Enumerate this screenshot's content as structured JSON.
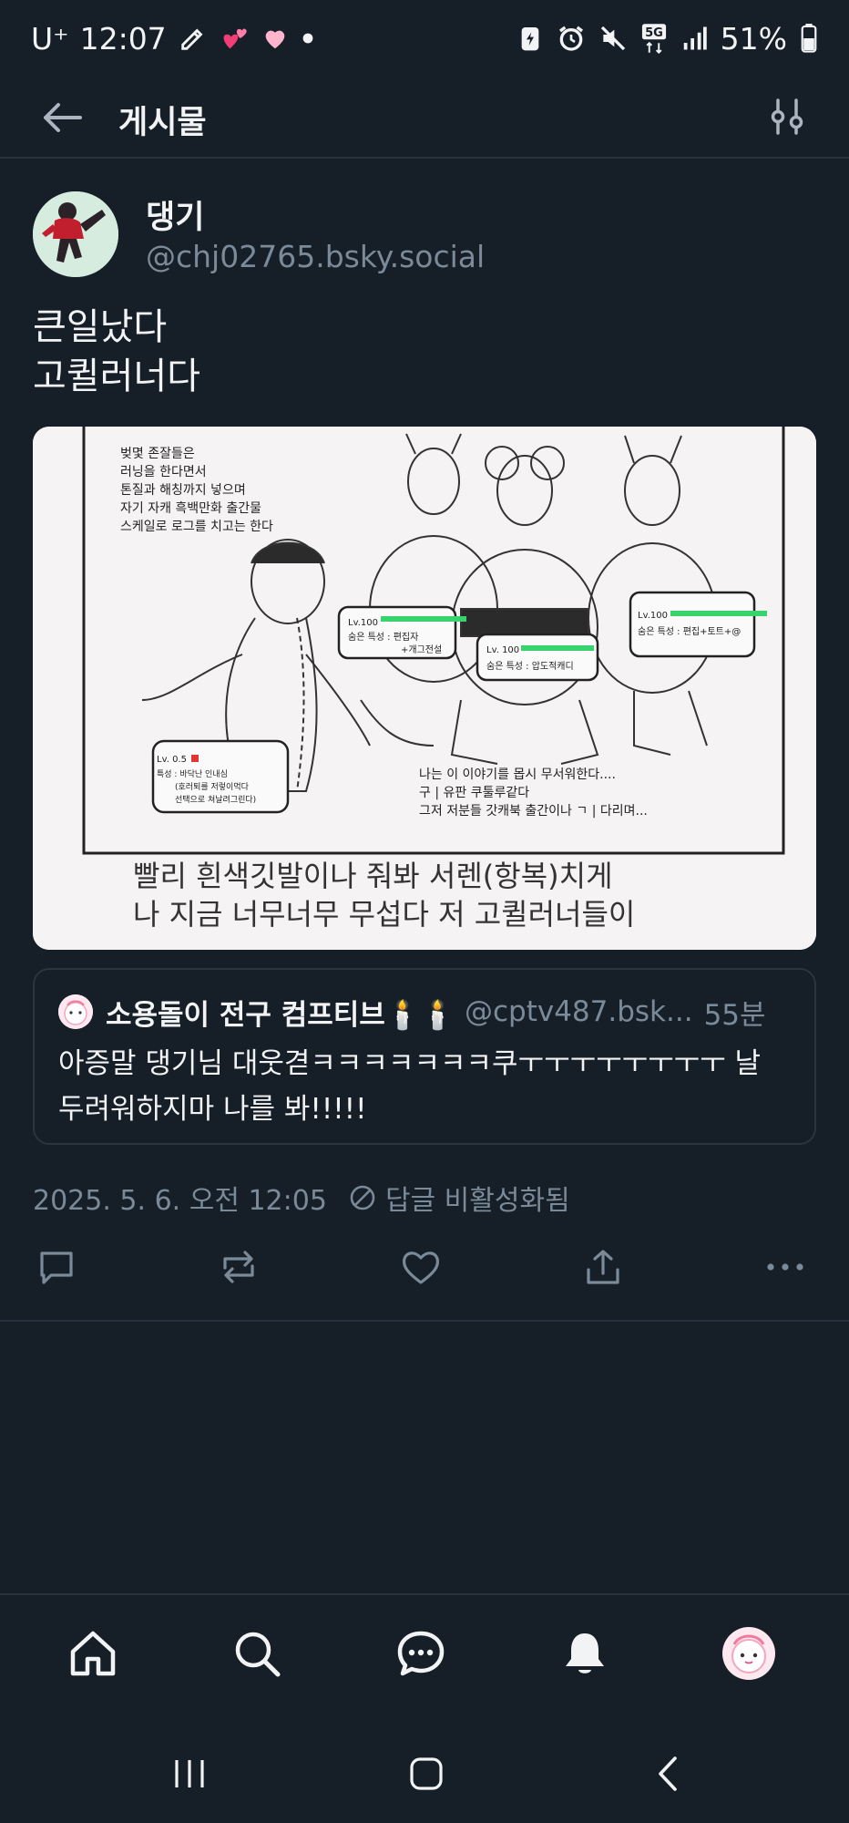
{
  "status_bar": {
    "carrier": "U⁺",
    "time": "12:07",
    "network": "5G",
    "battery": "51%",
    "icons": [
      "pencil-icon",
      "hearts-icon",
      "heart-icon",
      "dot-icon",
      "battery-saver-icon",
      "alarm-icon",
      "mute-icon",
      "signal-icon",
      "battery-icon"
    ]
  },
  "header": {
    "title": "게시물"
  },
  "post": {
    "author_name": "댕기",
    "author_handle": "@chj02765.bsky.social",
    "text_line1": "큰일났다",
    "text_line2": "고퀼러너다",
    "image": {
      "narration": [
        "벚몇 존잘들은",
        "러닝을 한다면서",
        "톤질과 해칭까지 넣으며",
        "자기 자캐 흑백만화 출간물",
        "스케일로 로그를 치고는 한다"
      ],
      "stat_box_left": {
        "level": "Lv.100",
        "trait": "숨은 특성 : 편집자",
        "trait2": "+개그전설"
      },
      "stat_box_middle": {
        "level": "Lv. 100",
        "trait": "숨은 특성 : 압도적캐디"
      },
      "stat_box_right": {
        "level": "Lv.100",
        "trait": "숨은 특성 : 편집+토트+@"
      },
      "stat_box_player": {
        "level": "Lv. 0.5",
        "trait": "특성 : 바닥난 인내심",
        "trait2": "(호러퇴를 저렇이먹다",
        "trait3": "선택으로 쳐날려그린다)"
      },
      "dialogue": [
        "나는 이 이야기를 몹시 무서워한다....",
        "구 | 유판 쿠툴루같다",
        "그저 저분들 갓캐북 출간이나 ㄱ | 다리며..."
      ],
      "caption_line1": "빨리 흰색깃발이나 줘봐 서렌(항복)치게",
      "caption_line2": "나 지금 너무너무 무섭다 저 고퀼러너들이"
    },
    "quote": {
      "author_name": "소용돌이 전구 컴프티브🕯️🕯️",
      "author_handle": "@cptv487.bsk...",
      "time": "55분",
      "text_line1": "아증말 댕기님 대웃겯ㅋㅋㅋㅋㅋㅋㅋ쿠ㅜㅜㅜㅜㅜㅜㅜㅜ 날",
      "text_line2": "두려워하지마 나를 봐!!!!!"
    },
    "timestamp": "2025. 5. 6. 오전 12:05",
    "reply_status": "답글 비활성화됨"
  },
  "colors": {
    "background": "#161e27",
    "text": "#f1f3f5",
    "muted": "#7b8a99",
    "border": "#26313d",
    "stat_green": "#37d36b",
    "stat_red": "#e23434"
  }
}
